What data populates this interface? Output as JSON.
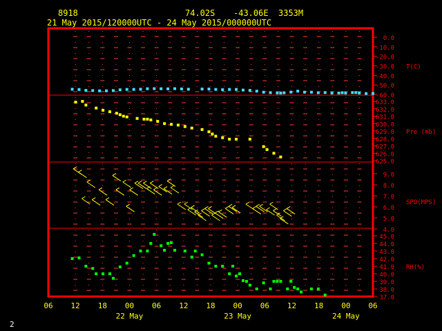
{
  "header": {
    "station_id": "8918",
    "lat": "74.02S",
    "lon": "-43.06E",
    "elev": "3353M",
    "time_range": "21 May 2015/120000UTC - 24 May 2015/000000UTC"
  },
  "corner_label": "2",
  "colors": {
    "frame": "#ff0000",
    "tick": "#ff4040",
    "text_yellow": "#ffff00",
    "label_red": "#ff0000",
    "temp": "#40e0ff",
    "pres": "#ffff00",
    "wind": "#ffff00",
    "rh": "#00ff00",
    "background": "#000000"
  },
  "chart_data": {
    "type": "scatter",
    "x_axis": {
      "unit": "hours from 21 May 2015 06UTC",
      "range": [
        0,
        72
      ],
      "tick_labels": [
        "06",
        "12",
        "18",
        "00",
        "06",
        "12",
        "18",
        "00",
        "06",
        "12",
        "18",
        "00",
        "06"
      ],
      "day_labels": [
        {
          "label": "22 May",
          "x": 18
        },
        {
          "label": "23 May",
          "x": 42
        },
        {
          "label": "24 May",
          "x": 66
        }
      ]
    },
    "panels": [
      {
        "name": "T(C)",
        "range": [
          -60,
          0
        ],
        "ticks": [
          "0.0",
          "-10.0",
          "-20.0",
          "-30.0",
          "-40.0",
          "-50.0",
          "-60.0"
        ],
        "tick_values": [
          0,
          -10,
          -20,
          -30,
          -40,
          -50,
          -60
        ],
        "points": [
          [
            8,
            -54.5
          ],
          [
            10,
            -54.8
          ],
          [
            12,
            -55.7
          ],
          [
            14,
            -55.9
          ],
          [
            16,
            -56.2
          ],
          [
            18,
            -56.2
          ],
          [
            20,
            -55.9
          ],
          [
            22,
            -55.1
          ],
          [
            24,
            -54.7
          ],
          [
            26,
            -54.7
          ],
          [
            28,
            -54.5
          ],
          [
            30,
            -54.0
          ],
          [
            32,
            -53.9
          ],
          [
            34,
            -54.0
          ],
          [
            36,
            -54.1
          ],
          [
            38,
            -53.9
          ],
          [
            40,
            -54.2
          ],
          [
            42,
            -54.5
          ],
          [
            46,
            -54.3
          ],
          [
            48,
            -54.3
          ],
          [
            50,
            -54.7
          ],
          [
            52,
            -55.0
          ],
          [
            54,
            -54.7
          ],
          [
            56,
            -54.7
          ],
          [
            58,
            -55.4
          ],
          [
            60,
            -55.7
          ],
          [
            62,
            -56.5
          ],
          [
            64,
            -57.6
          ],
          [
            66,
            -58.1
          ],
          [
            68,
            -58.4
          ],
          [
            69,
            -58.5
          ],
          [
            70,
            -58.2
          ],
          [
            72,
            -57.5
          ],
          [
            74,
            -56.5
          ],
          [
            76,
            -57.6
          ],
          [
            78,
            -57.6
          ],
          [
            80,
            -58.2
          ],
          [
            82,
            -58.0
          ],
          [
            84,
            -58.5
          ],
          [
            86,
            -58.5
          ],
          [
            87,
            -58.2
          ],
          [
            88,
            -58.5
          ],
          [
            90,
            -58.0
          ],
          [
            91,
            -58.0
          ],
          [
            92,
            -58.5
          ],
          [
            94,
            -59.0
          ],
          [
            96,
            -59.0
          ]
        ]
      },
      {
        "name": "Pre (mb)",
        "range": [
          625,
          634
        ],
        "ticks": [
          "633.0",
          "632.0",
          "631.0",
          "630.0",
          "629.0",
          "628.0",
          "627.0",
          "626.0",
          "625.0"
        ],
        "tick_values": [
          633,
          632,
          631,
          630,
          629,
          628,
          627,
          626,
          625
        ],
        "points": [
          [
            9,
            632.9
          ],
          [
            11,
            633.0
          ],
          [
            12,
            632.5
          ],
          [
            15,
            632.1
          ],
          [
            17,
            631.8
          ],
          [
            19,
            631.6
          ],
          [
            21,
            631.4
          ],
          [
            22,
            631.2
          ],
          [
            23,
            631.0
          ],
          [
            24,
            630.9
          ],
          [
            27,
            630.7
          ],
          [
            29,
            630.6
          ],
          [
            30,
            630.6
          ],
          [
            31,
            630.5
          ],
          [
            33,
            630.3
          ],
          [
            35,
            630.0
          ],
          [
            37,
            629.9
          ],
          [
            39,
            629.8
          ],
          [
            41,
            629.6
          ],
          [
            43,
            629.4
          ],
          [
            46,
            629.2
          ],
          [
            48,
            628.9
          ],
          [
            49,
            628.6
          ],
          [
            50,
            628.3
          ],
          [
            52,
            628.1
          ],
          [
            54,
            627.9
          ],
          [
            56,
            627.9
          ],
          [
            57,
            627.9
          ],
          [
            61,
            626.9
          ],
          [
            62,
            626.5
          ],
          [
            64,
            626.0
          ],
          [
            66,
            625.5
          ]
        ]
      },
      {
        "name": "SPD(MPS)",
        "range": [
          4,
          9.5
        ],
        "ticks": [
          "9.0",
          "8.0",
          "7.0",
          "6.0",
          "5.0",
          "4.0"
        ],
        "tick_values": [
          9,
          8,
          7,
          6,
          5,
          4
        ],
        "points": [
          [
            9.5,
            9.2
          ],
          [
            11,
            8.9
          ],
          [
            12,
            6.5
          ],
          [
            13.5,
            8.0
          ],
          [
            15,
            6.4
          ],
          [
            17,
            7.3
          ],
          [
            19,
            6.4
          ],
          [
            21,
            8.6
          ],
          [
            22,
            7.3
          ],
          [
            24,
            8.0
          ],
          [
            25,
            5.8
          ],
          [
            26,
            7.3
          ],
          [
            27.5,
            7.9
          ],
          [
            28.5,
            7.9
          ],
          [
            30,
            7.9
          ],
          [
            31,
            7.4
          ],
          [
            32,
            7.9
          ],
          [
            33,
            7.3
          ],
          [
            34.5,
            7.6
          ],
          [
            36,
            7.4
          ],
          [
            37,
            8.1
          ],
          [
            38,
            7.5
          ],
          [
            40,
            6.0
          ],
          [
            42,
            6.0
          ],
          [
            43,
            5.5
          ],
          [
            44,
            5.7
          ],
          [
            45,
            5.3
          ],
          [
            46,
            5.0
          ],
          [
            47,
            5.4
          ],
          [
            48,
            5.6
          ],
          [
            49,
            5.6
          ],
          [
            50,
            5.0
          ],
          [
            51,
            5.2
          ],
          [
            52,
            5.3
          ],
          [
            54,
            5.6
          ],
          [
            55,
            5.8
          ],
          [
            56,
            5.7
          ],
          [
            60,
            6.0
          ],
          [
            62,
            5.6
          ],
          [
            63,
            5.8
          ],
          [
            64,
            5.8
          ],
          [
            66,
            5.5
          ],
          [
            67,
            6.0
          ],
          [
            68,
            5.4
          ],
          [
            69,
            5.0
          ],
          [
            70,
            4.7
          ],
          [
            71,
            5.4
          ],
          [
            72,
            5.6
          ]
        ]
      },
      {
        "name": "RH(%)",
        "range": [
          37,
          45.5
        ],
        "ticks": [
          "45.0",
          "44.0",
          "43.0",
          "42.0",
          "41.0",
          "40.0",
          "39.0",
          "38.0",
          "37.0"
        ],
        "tick_values": [
          45,
          44,
          43,
          42,
          41,
          40,
          39,
          38,
          37
        ],
        "points": [
          [
            8,
            42.0
          ],
          [
            10,
            42.1
          ],
          [
            12,
            41.0
          ],
          [
            14,
            40.7
          ],
          [
            15,
            40.0
          ],
          [
            17,
            40.0
          ],
          [
            19,
            40.0
          ],
          [
            20,
            39.4
          ],
          [
            22,
            40.9
          ],
          [
            24,
            41.4
          ],
          [
            26,
            42.4
          ],
          [
            28,
            43.0
          ],
          [
            30,
            43.0
          ],
          [
            31,
            44.0
          ],
          [
            32,
            45.2
          ],
          [
            34,
            43.7
          ],
          [
            35,
            43.1
          ],
          [
            36,
            44.0
          ],
          [
            37,
            44.1
          ],
          [
            38,
            43.1
          ],
          [
            41,
            43.0
          ],
          [
            43,
            42.2
          ],
          [
            44,
            43.0
          ],
          [
            46,
            42.5
          ],
          [
            48,
            41.4
          ],
          [
            50,
            41.0
          ],
          [
            52,
            41.0
          ],
          [
            54,
            40.0
          ],
          [
            55,
            41.0
          ],
          [
            56,
            39.7
          ],
          [
            57,
            40.0
          ],
          [
            58,
            39.1
          ],
          [
            59,
            39.0
          ],
          [
            60,
            38.5
          ],
          [
            62,
            38.0
          ],
          [
            64,
            38.8
          ],
          [
            66,
            38.0
          ],
          [
            67,
            39.0
          ],
          [
            68,
            39.0
          ],
          [
            69,
            39.0
          ],
          [
            71,
            38.0
          ],
          [
            72,
            39.0
          ],
          [
            73,
            38.2
          ],
          [
            74,
            38.0
          ],
          [
            75,
            37.6
          ],
          [
            78,
            38.0
          ],
          [
            80,
            38.0
          ],
          [
            82,
            37.2
          ]
        ]
      }
    ],
    "grid": "dashed vertical grid every 3 hours with plus marks"
  }
}
